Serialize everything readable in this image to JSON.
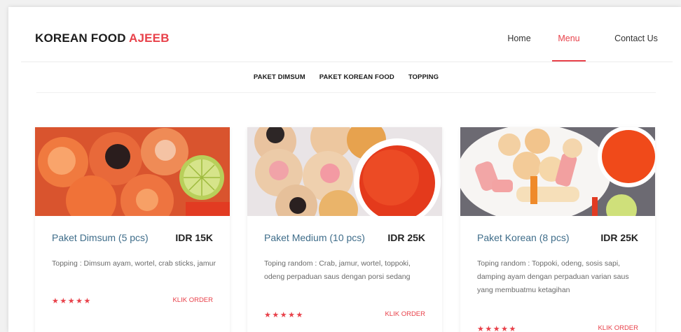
{
  "header": {
    "brand_main": "KOREAN FOOD",
    "brand_accent": "AJEEB",
    "nav": [
      {
        "label": "Home"
      },
      {
        "label": "Menu"
      },
      {
        "label": "Contact Us"
      }
    ]
  },
  "tabs": [
    {
      "label": "PAKET DIMSUM"
    },
    {
      "label": "PAKET KOREAN FOOD"
    },
    {
      "label": "TOPPING"
    }
  ],
  "cards": [
    {
      "title": "Paket Dimsum (5 pcs)",
      "price": "IDR 15K",
      "description": "Topping : Dimsum ayam, wortel, crab sticks, jamur",
      "rating": 5,
      "rating_text": "★★★★★",
      "order_label": "KLIK ORDER"
    },
    {
      "title": "Paket Medium (10 pcs)",
      "price": "IDR 25K",
      "description": "Toping random : Crab, jamur, wortel, toppoki, odeng perpaduan saus dengan porsi sedang",
      "rating": 5,
      "rating_text": "★★★★★",
      "order_label": "KLIK ORDER"
    },
    {
      "title": "Paket Korean (8 pcs)",
      "price": "IDR 25K",
      "description": "Toping random : Toppoki, odeng, sosis sapi, damping ayam dengan perpaduan varian saus yang membuatmu ketagihan",
      "rating": 5,
      "rating_text": "★★★★★",
      "order_label": "KLIK ORDER"
    }
  ],
  "colors": {
    "accent": "#e8414a",
    "title_blue": "#3f6d8a"
  }
}
